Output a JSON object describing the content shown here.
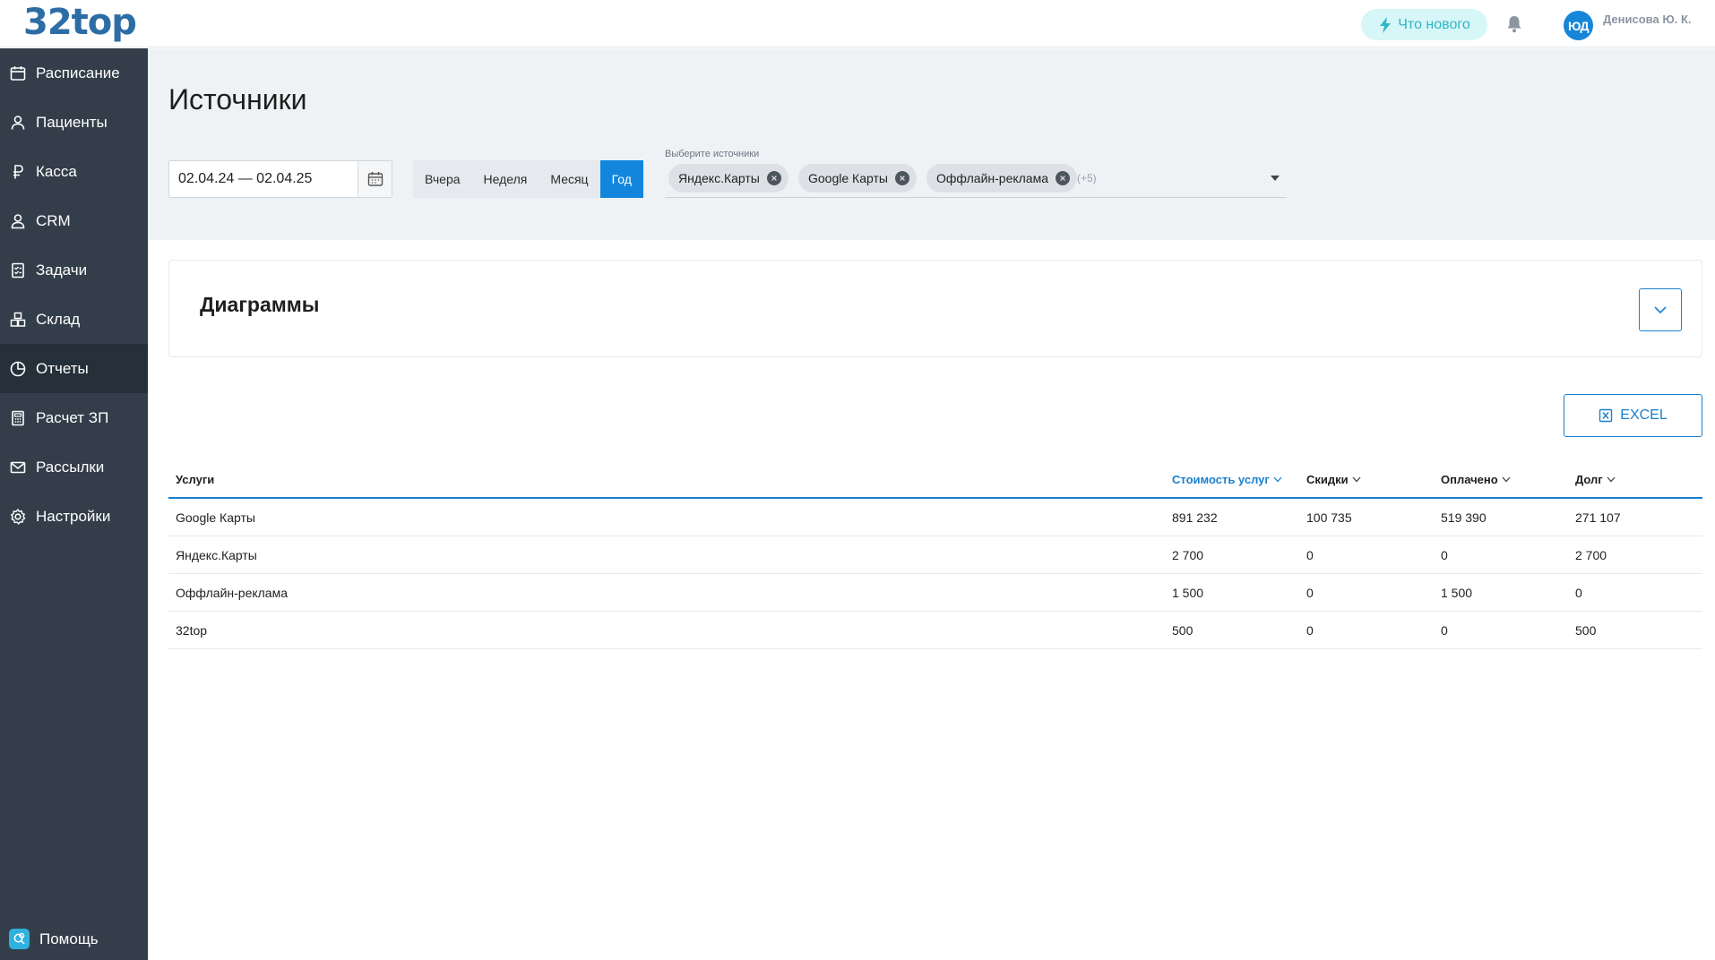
{
  "app": {
    "logo": "32top"
  },
  "topbar": {
    "whats_new_label": "Что нового",
    "avatar_initials": "ЮД",
    "user_name": "Денисова Ю. К."
  },
  "sidebar": {
    "items": [
      {
        "label": "Расписание",
        "icon": "calendar-icon"
      },
      {
        "label": "Пациенты",
        "icon": "person-icon"
      },
      {
        "label": "Касса",
        "icon": "ruble-icon"
      },
      {
        "label": "CRM",
        "icon": "crm-person-icon"
      },
      {
        "label": "Задачи",
        "icon": "checklist-icon"
      },
      {
        "label": "Склад",
        "icon": "boxes-icon"
      },
      {
        "label": "Отчеты",
        "icon": "pie-chart-icon",
        "active": true
      },
      {
        "label": "Расчет ЗП",
        "icon": "calculator-icon"
      },
      {
        "label": "Рассылки",
        "icon": "mail-icon"
      },
      {
        "label": "Настройки",
        "icon": "gear-icon"
      }
    ],
    "help_label": "Помощь"
  },
  "page": {
    "title": "Источники"
  },
  "filters": {
    "date_range": "02.04.24 — 02.04.25",
    "periods": [
      "Вчера",
      "Неделя",
      "Месяц",
      "Год"
    ],
    "active_period": "Год",
    "sources_label": "Выберите источники",
    "selected_sources": [
      "Яндекс.Карты",
      "Google Карты",
      "Оффлайн-реклама"
    ],
    "more_sources": "(+5)"
  },
  "diagrams": {
    "title": "Диаграммы"
  },
  "export": {
    "excel_label": "EXCEL"
  },
  "table": {
    "columns": [
      "Услуги",
      "Стоимость услуг",
      "Скидки",
      "Оплачено",
      "Долг"
    ],
    "sorted_column": "Стоимость услуг",
    "rows": [
      [
        "Google Карты",
        "891 232",
        "100 735",
        "519 390",
        "271 107"
      ],
      [
        "Яндекс.Карты",
        "2 700",
        "0",
        "0",
        "2 700"
      ],
      [
        "Оффлайн-реклама",
        "1 500",
        "0",
        "1 500",
        "0"
      ],
      [
        "32top",
        "500",
        "0",
        "0",
        "500"
      ]
    ]
  },
  "colors": {
    "accent": "#1186dc",
    "sidebar_bg": "#333e4a",
    "sidebar_active_bg": "#26303b",
    "panel_bg": "#eef2f5",
    "logo": "#2d6da6",
    "whats_new_bg": "#d7f6f7",
    "whats_new_text": "#2fb6c6"
  }
}
